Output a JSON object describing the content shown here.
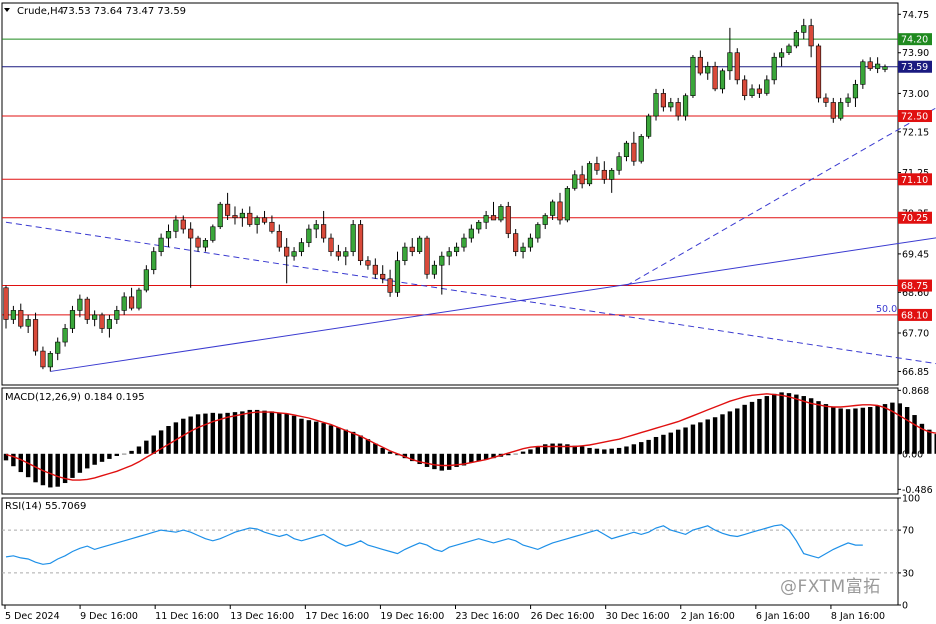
{
  "header": {
    "symbol": "Crude,H4",
    "ohlc": "73.53 73.64 73.47 73.59"
  },
  "watermark": "@FXTM富拓",
  "colors": {
    "bull": "#3aa63a",
    "bear": "#d94a3a",
    "wick": "#000000",
    "support_line": "#e01010",
    "resistance_line": "#1f8a1f",
    "current_line": "#1a1a80",
    "trend_line": "#3a3ad0",
    "macd_hist": "#000000",
    "macd_signal": "#e01010",
    "rsi_line": "#1e90e8",
    "label_red": "#e01010",
    "label_green": "#1f8a1f",
    "label_navy": "#1a1a80",
    "grid": "#888888"
  },
  "chart_data": [
    {
      "type": "candlestick",
      "title": "Crude,H4",
      "ylim": [
        66.55,
        75.0
      ],
      "y_ticks": [
        "74.75",
        "73.90",
        "73.00",
        "72.15",
        "71.25",
        "70.35",
        "69.45",
        "68.60",
        "67.70",
        "66.85"
      ],
      "x_ticks": [
        "5 Dec 2024",
        "9 Dec 16:00",
        "11 Dec 16:00",
        "13 Dec 16:00",
        "17 Dec 16:00",
        "19 Dec 16:00",
        "23 Dec 16:00",
        "26 Dec 16:00",
        "30 Dec 16:00",
        "2 Jan 16:00",
        "6 Jan 16:00",
        "8 Jan 16:00"
      ],
      "levels": [
        {
          "value": 74.2,
          "label": "74.20",
          "style": "resistance"
        },
        {
          "value": 73.59,
          "label": "73.59",
          "style": "current"
        },
        {
          "value": 72.5,
          "label": "72.50",
          "style": "support"
        },
        {
          "value": 71.1,
          "label": "71.10",
          "style": "support"
        },
        {
          "value": 70.25,
          "label": "70.25",
          "style": "support"
        },
        {
          "value": 68.75,
          "label": "68.75",
          "style": "support"
        },
        {
          "value": 68.1,
          "label": "68.10",
          "style": "support"
        }
      ],
      "level_annotation": {
        "text": "50.0",
        "value": 68.1
      },
      "trendlines": [
        {
          "points": [
            [
              0,
              70.15
            ],
            [
              145,
              66.55
            ]
          ],
          "style": "dashed"
        },
        {
          "points": [
            [
              6,
              66.85
            ],
            [
              148,
              70.35
            ]
          ],
          "style": "solid"
        },
        {
          "points": [
            [
              84,
              68.75
            ],
            [
              148,
              74.75
            ]
          ],
          "style": "dashed"
        }
      ],
      "candles": [
        [
          68.7,
          68.75,
          67.8,
          68.0
        ],
        [
          68.0,
          68.3,
          67.9,
          68.2
        ],
        [
          68.2,
          68.35,
          67.8,
          67.85
        ],
        [
          67.85,
          68.1,
          67.7,
          68.0
        ],
        [
          68.0,
          68.15,
          67.2,
          67.3
        ],
        [
          67.3,
          67.4,
          66.9,
          66.95
        ],
        [
          66.95,
          67.3,
          66.85,
          67.25
        ],
        [
          67.25,
          67.6,
          67.1,
          67.5
        ],
        [
          67.5,
          67.9,
          67.4,
          67.8
        ],
        [
          67.8,
          68.3,
          67.7,
          68.2
        ],
        [
          68.2,
          68.55,
          68.05,
          68.45
        ],
        [
          68.45,
          68.5,
          67.9,
          68.0
        ],
        [
          68.0,
          68.2,
          67.85,
          68.1
        ],
        [
          68.1,
          68.15,
          67.7,
          67.8
        ],
        [
          67.8,
          68.1,
          67.6,
          68.0
        ],
        [
          68.0,
          68.3,
          67.9,
          68.2
        ],
        [
          68.2,
          68.6,
          68.1,
          68.5
        ],
        [
          68.5,
          68.7,
          68.2,
          68.25
        ],
        [
          68.25,
          68.7,
          68.2,
          68.65
        ],
        [
          68.65,
          69.2,
          68.6,
          69.1
        ],
        [
          69.1,
          69.6,
          69.0,
          69.5
        ],
        [
          69.5,
          69.9,
          69.4,
          69.8
        ],
        [
          69.8,
          70.1,
          69.6,
          69.95
        ],
        [
          69.95,
          70.3,
          69.8,
          70.2
        ],
        [
          70.2,
          70.3,
          69.9,
          70.0
        ],
        [
          70.0,
          70.15,
          68.7,
          69.8
        ],
        [
          69.8,
          69.85,
          69.5,
          69.6
        ],
        [
          69.6,
          69.8,
          69.5,
          69.75
        ],
        [
          69.75,
          70.1,
          69.7,
          70.05
        ],
        [
          70.05,
          70.6,
          70.0,
          70.55
        ],
        [
          70.55,
          70.8,
          70.2,
          70.3
        ],
        [
          70.3,
          70.5,
          70.1,
          70.25
        ],
        [
          70.25,
          70.45,
          70.05,
          70.35
        ],
        [
          70.35,
          70.5,
          70.05,
          70.1
        ],
        [
          70.1,
          70.3,
          69.9,
          70.25
        ],
        [
          70.25,
          70.4,
          70.1,
          70.15
        ],
        [
          70.15,
          70.3,
          69.9,
          69.95
        ],
        [
          69.95,
          70.1,
          69.5,
          69.6
        ],
        [
          69.6,
          69.8,
          68.8,
          69.4
        ],
        [
          69.4,
          69.6,
          69.3,
          69.5
        ],
        [
          69.5,
          69.8,
          69.4,
          69.7
        ],
        [
          69.7,
          70.1,
          69.6,
          70.0
        ],
        [
          70.0,
          70.2,
          69.8,
          70.1
        ],
        [
          70.1,
          70.4,
          69.7,
          69.8
        ],
        [
          69.8,
          69.9,
          69.4,
          69.5
        ],
        [
          69.5,
          69.65,
          69.3,
          69.4
        ],
        [
          69.4,
          69.6,
          69.2,
          69.5
        ],
        [
          69.5,
          70.2,
          69.4,
          70.1
        ],
        [
          70.1,
          70.2,
          69.2,
          69.3
        ],
        [
          69.3,
          69.4,
          69.1,
          69.2
        ],
        [
          69.2,
          69.35,
          68.9,
          69.0
        ],
        [
          69.0,
          69.2,
          68.8,
          68.9
        ],
        [
          68.9,
          69.1,
          68.5,
          68.6
        ],
        [
          68.6,
          69.5,
          68.5,
          69.3
        ],
        [
          69.3,
          69.7,
          69.2,
          69.6
        ],
        [
          69.6,
          69.8,
          69.4,
          69.5
        ],
        [
          69.5,
          69.85,
          69.45,
          69.8
        ],
        [
          69.8,
          69.85,
          68.9,
          69.0
        ],
        [
          69.0,
          69.3,
          68.9,
          69.2
        ],
        [
          69.2,
          69.5,
          68.55,
          69.4
        ],
        [
          69.4,
          69.6,
          69.2,
          69.5
        ],
        [
          69.5,
          69.7,
          69.4,
          69.6
        ],
        [
          69.6,
          69.9,
          69.5,
          69.8
        ],
        [
          69.8,
          70.1,
          69.7,
          70.0
        ],
        [
          70.0,
          70.2,
          69.9,
          70.15
        ],
        [
          70.15,
          70.4,
          70.0,
          70.3
        ],
        [
          70.3,
          70.6,
          70.2,
          70.2
        ],
        [
          70.2,
          70.55,
          70.15,
          70.5
        ],
        [
          70.5,
          70.6,
          69.8,
          69.9
        ],
        [
          69.9,
          70.0,
          69.4,
          69.5
        ],
        [
          69.5,
          69.7,
          69.35,
          69.6
        ],
        [
          69.6,
          69.9,
          69.5,
          69.8
        ],
        [
          69.8,
          70.15,
          69.7,
          70.1
        ],
        [
          70.1,
          70.35,
          70.0,
          70.3
        ],
        [
          70.3,
          70.65,
          70.2,
          70.6
        ],
        [
          70.6,
          70.8,
          70.1,
          70.2
        ],
        [
          70.2,
          70.95,
          70.15,
          70.9
        ],
        [
          70.9,
          71.3,
          70.85,
          71.2
        ],
        [
          71.2,
          71.4,
          70.9,
          71.0
        ],
        [
          71.0,
          71.5,
          70.95,
          71.45
        ],
        [
          71.45,
          71.6,
          71.2,
          71.3
        ],
        [
          71.3,
          71.5,
          71.0,
          71.1
        ],
        [
          71.1,
          71.35,
          70.8,
          71.3
        ],
        [
          71.3,
          71.7,
          71.2,
          71.6
        ],
        [
          71.6,
          71.95,
          71.5,
          71.9
        ],
        [
          71.9,
          72.15,
          71.4,
          71.5
        ],
        [
          71.5,
          72.1,
          71.45,
          72.05
        ],
        [
          72.05,
          72.55,
          72.0,
          72.5
        ],
        [
          72.5,
          73.1,
          72.4,
          73.0
        ],
        [
          73.0,
          73.1,
          72.6,
          72.7
        ],
        [
          72.7,
          72.9,
          72.6,
          72.8
        ],
        [
          72.8,
          72.9,
          72.4,
          72.5
        ],
        [
          72.5,
          73.0,
          72.4,
          72.95
        ],
        [
          72.95,
          73.85,
          72.9,
          73.8
        ],
        [
          73.8,
          73.95,
          73.4,
          73.45
        ],
        [
          73.45,
          73.7,
          73.3,
          73.6
        ],
        [
          73.6,
          73.7,
          73.05,
          73.1
        ],
        [
          73.1,
          73.55,
          73.0,
          73.5
        ],
        [
          73.5,
          74.45,
          73.3,
          73.9
        ],
        [
          73.9,
          74.0,
          73.2,
          73.3
        ],
        [
          73.3,
          73.4,
          72.85,
          72.95
        ],
        [
          72.95,
          73.2,
          72.9,
          73.1
        ],
        [
          73.1,
          73.2,
          72.9,
          73.0
        ],
        [
          73.0,
          73.4,
          72.95,
          73.3
        ],
        [
          73.3,
          73.9,
          73.2,
          73.8
        ],
        [
          73.8,
          74.0,
          73.6,
          73.9
        ],
        [
          73.9,
          74.1,
          73.85,
          74.05
        ],
        [
          74.05,
          74.4,
          74.0,
          74.35
        ],
        [
          74.35,
          74.65,
          74.2,
          74.5
        ],
        [
          74.5,
          74.65,
          73.8,
          74.05
        ],
        [
          74.05,
          74.1,
          72.8,
          72.9
        ],
        [
          72.9,
          73.0,
          72.7,
          72.8
        ],
        [
          72.8,
          72.9,
          72.35,
          72.45
        ],
        [
          72.45,
          72.9,
          72.4,
          72.8
        ],
        [
          72.8,
          73.0,
          72.7,
          72.9
        ],
        [
          72.9,
          73.3,
          72.7,
          73.2
        ],
        [
          73.2,
          73.75,
          73.1,
          73.7
        ],
        [
          73.7,
          73.8,
          73.5,
          73.55
        ],
        [
          73.55,
          73.8,
          73.45,
          73.65
        ],
        [
          73.53,
          73.64,
          73.47,
          73.59
        ]
      ]
    },
    {
      "type": "bar",
      "title": "MACD(12,26,9) 0.184 0.195",
      "ylim": [
        -0.55,
        0.9
      ],
      "y_ticks": [
        "0.868",
        "0.00",
        "-0.486"
      ],
      "histogram": [
        -0.09,
        -0.17,
        -0.25,
        -0.32,
        -0.39,
        -0.43,
        -0.46,
        -0.45,
        -0.4,
        -0.33,
        -0.26,
        -0.2,
        -0.15,
        -0.11,
        -0.07,
        -0.03,
        0.0,
        0.04,
        0.1,
        0.18,
        0.25,
        0.32,
        0.38,
        0.43,
        0.48,
        0.51,
        0.54,
        0.55,
        0.56,
        0.55,
        0.56,
        0.57,
        0.58,
        0.6,
        0.6,
        0.59,
        0.58,
        0.56,
        0.55,
        0.52,
        0.48,
        0.46,
        0.44,
        0.42,
        0.39,
        0.36,
        0.33,
        0.3,
        0.25,
        0.2,
        0.14,
        0.08,
        0.03,
        -0.02,
        -0.06,
        -0.1,
        -0.14,
        -0.18,
        -0.21,
        -0.23,
        -0.22,
        -0.18,
        -0.16,
        -0.12,
        -0.1,
        -0.08,
        -0.06,
        -0.04,
        -0.02,
        0.0,
        0.03,
        0.06,
        0.1,
        0.13,
        0.14,
        0.14,
        0.13,
        0.11,
        0.1,
        0.08,
        0.07,
        0.06,
        0.07,
        0.08,
        0.1,
        0.13,
        0.16,
        0.19,
        0.23,
        0.26,
        0.29,
        0.33,
        0.36,
        0.4,
        0.43,
        0.47,
        0.5,
        0.54,
        0.58,
        0.62,
        0.67,
        0.71,
        0.75,
        0.79,
        0.82,
        0.84,
        0.83,
        0.81,
        0.79,
        0.76,
        0.72,
        0.68,
        0.64,
        0.62,
        0.61,
        0.62,
        0.63,
        0.64,
        0.66,
        0.68,
        0.7,
        0.69,
        0.64,
        0.53,
        0.41,
        0.33,
        0.27,
        0.24,
        0.23,
        0.24,
        0.25
      ],
      "signal": [
        -0.01,
        -0.04,
        -0.08,
        -0.13,
        -0.18,
        -0.23,
        -0.27,
        -0.31,
        -0.34,
        -0.36,
        -0.36,
        -0.35,
        -0.33,
        -0.3,
        -0.27,
        -0.24,
        -0.2,
        -0.16,
        -0.11,
        -0.05,
        0.01,
        0.07,
        0.13,
        0.19,
        0.25,
        0.31,
        0.36,
        0.4,
        0.44,
        0.47,
        0.5,
        0.52,
        0.54,
        0.56,
        0.57,
        0.57,
        0.57,
        0.56,
        0.55,
        0.53,
        0.51,
        0.49,
        0.46,
        0.43,
        0.4,
        0.36,
        0.32,
        0.28,
        0.24,
        0.19,
        0.14,
        0.09,
        0.04,
        0.0,
        -0.04,
        -0.08,
        -0.11,
        -0.13,
        -0.15,
        -0.16,
        -0.16,
        -0.15,
        -0.14,
        -0.12,
        -0.1,
        -0.08,
        -0.05,
        -0.02,
        0.01,
        0.04,
        0.07,
        0.09,
        0.1,
        0.1,
        0.1,
        0.1,
        0.1,
        0.1,
        0.11,
        0.12,
        0.14,
        0.16,
        0.18,
        0.2,
        0.23,
        0.26,
        0.29,
        0.32,
        0.35,
        0.38,
        0.41,
        0.44,
        0.48,
        0.52,
        0.56,
        0.6,
        0.64,
        0.68,
        0.72,
        0.75,
        0.78,
        0.8,
        0.81,
        0.82,
        0.81,
        0.8,
        0.78,
        0.75,
        0.72,
        0.69,
        0.67,
        0.65,
        0.64,
        0.64,
        0.65,
        0.66,
        0.67,
        0.67,
        0.66,
        0.63,
        0.58,
        0.52,
        0.46,
        0.4,
        0.34,
        0.3,
        0.28,
        0.27,
        0.26
      ]
    },
    {
      "type": "line",
      "title": "RSI(14) 55.7069",
      "ylim": [
        0,
        100
      ],
      "y_ticks": [
        "100",
        "70",
        "30",
        "0"
      ],
      "guides": [
        70,
        30
      ],
      "values": [
        45,
        46,
        44,
        43,
        40,
        38,
        39,
        43,
        46,
        50,
        53,
        55,
        52,
        54,
        56,
        58,
        60,
        62,
        64,
        66,
        68,
        70,
        69,
        68,
        70,
        68,
        65,
        62,
        60,
        62,
        65,
        68,
        70,
        72,
        71,
        68,
        66,
        64,
        66,
        62,
        60,
        62,
        64,
        66,
        62,
        58,
        55,
        57,
        60,
        56,
        54,
        52,
        50,
        48,
        52,
        55,
        58,
        56,
        52,
        50,
        54,
        56,
        58,
        60,
        62,
        60,
        58,
        60,
        62,
        60,
        56,
        54,
        52,
        55,
        58,
        60,
        62,
        64,
        66,
        68,
        70,
        66,
        62,
        64,
        66,
        68,
        66,
        68,
        72,
        74,
        70,
        68,
        66,
        70,
        72,
        74,
        70,
        67,
        65,
        64,
        66,
        68,
        70,
        72,
        74,
        75,
        70,
        60,
        48,
        46,
        44,
        48,
        52,
        55,
        58,
        56,
        56
      ]
    }
  ]
}
